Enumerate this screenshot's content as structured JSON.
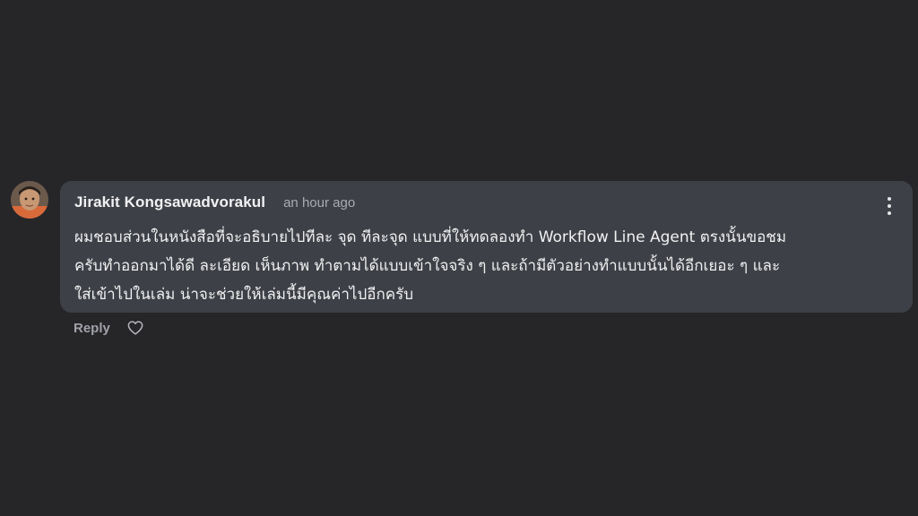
{
  "comment": {
    "author": "Jirakit Kongsawadvorakul",
    "timestamp": "an hour ago",
    "body": "ผมชอบส่วนในหนังสือที่จะอธิบายไปทีละ จุด ทีละจุด แบบที่ให้ทดลองทำ Workflow Line Agent ตรงนั้นขอชม\nครับทำออกมาได้ดี ละเอียด เห็นภาพ ทำตามได้แบบเข้าใจจริง ๆ และถ้ามีตัวอย่างทำแบบนั้นได้อีกเยอะ ๆ และ\nใส่เข้าไปในเล่ม น่าจะช่วยให้เล่มนี้มีคุณค่าไปอีกครับ",
    "reply_label": "Reply",
    "icons": {
      "more": "more-vertical-icon",
      "like": "heart-icon"
    }
  },
  "colors": {
    "background": "#262629",
    "bubble": "#3e4047"
  }
}
